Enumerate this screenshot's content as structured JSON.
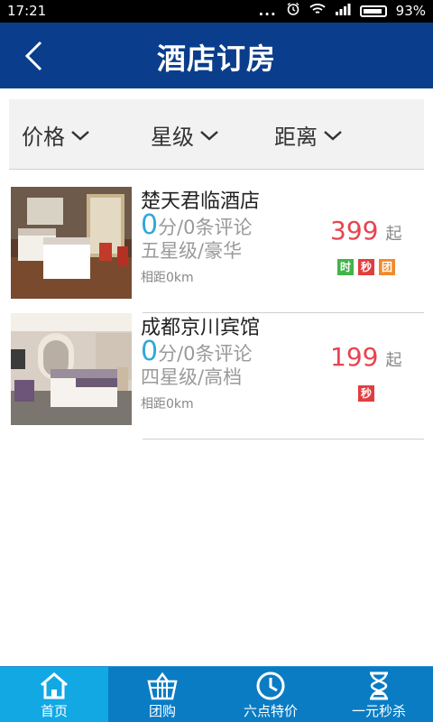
{
  "status": {
    "time": "17:21",
    "dots": "...",
    "battery": "93%"
  },
  "header": {
    "title": "酒店订房"
  },
  "filters": [
    {
      "label": "价格"
    },
    {
      "label": "星级"
    },
    {
      "label": "距离"
    }
  ],
  "hotels": [
    {
      "name": "楚天君临酒店",
      "score": "0",
      "reviews": "分/0条评论",
      "star": "五星级/豪华",
      "distance": "相距0km",
      "price": "399",
      "price_suffix": "起",
      "badges": [
        {
          "text": "时",
          "color": "#43b34a"
        },
        {
          "text": "秒",
          "color": "#e23d3d"
        },
        {
          "text": "团",
          "color": "#f08a2b"
        }
      ]
    },
    {
      "name": "成都京川宾馆",
      "score": "0",
      "reviews": "分/0条评论",
      "star": "四星级/高档",
      "distance": "相距0km",
      "price": "199",
      "price_suffix": "起",
      "badges": [
        {
          "text": "秒",
          "color": "#e23d3d"
        }
      ]
    }
  ],
  "tabbar": {
    "items": [
      {
        "label": "首页",
        "icon": "home-icon",
        "active": true
      },
      {
        "label": "团购",
        "icon": "basket-icon",
        "active": false
      },
      {
        "label": "六点特价",
        "icon": "clock-icon",
        "active": false
      },
      {
        "label": "一元秒杀",
        "icon": "hourglass-icon",
        "active": false
      }
    ]
  },
  "colors": {
    "header_blue": "#0a3e8c",
    "tab_blue": "#0a7cc4",
    "tab_active": "#11a8e4",
    "price_red": "#e8444f",
    "score_blue": "#32a8d8"
  }
}
